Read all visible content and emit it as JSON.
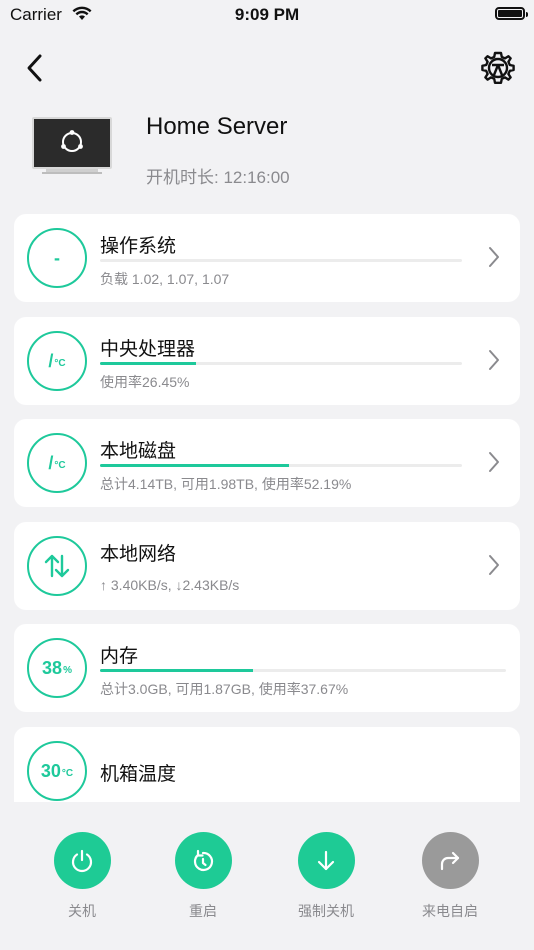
{
  "status_bar": {
    "carrier": "Carrier",
    "time": "9:09 PM"
  },
  "server": {
    "name": "Home Server",
    "uptime": "开机时长: 12:16:00"
  },
  "cards": [
    {
      "title": "操作系统",
      "ring_text": "-",
      "ring_unit": "",
      "subtitle": "负载 1.02, 1.07, 1.07",
      "progress": 0,
      "chevron": true
    },
    {
      "title": "中央处理器",
      "ring_text": "/",
      "ring_unit": "°C",
      "subtitle": "使用率26.45%",
      "progress": 0.2645,
      "chevron": true
    },
    {
      "title": "本地磁盘",
      "ring_text": "/",
      "ring_unit": "°C",
      "subtitle": "总计4.14TB, 可用1.98TB, 使用率52.19%",
      "progress": 0.5219,
      "chevron": true
    },
    {
      "title": "本地网络",
      "ring_icon": "up-down-arrows-icon",
      "subtitle": "↑ 3.40KB/s, ↓2.43KB/s",
      "chevron": true
    },
    {
      "title": "内存",
      "ring_text": "38",
      "ring_unit": "%",
      "subtitle": "总计3.0GB, 可用1.87GB, 使用率37.67%",
      "progress": 0.3767,
      "chevron": false
    },
    {
      "title": "机箱温度",
      "ring_text": "30",
      "ring_unit": "°C",
      "chevron": false
    }
  ],
  "actions": [
    {
      "label": "关机",
      "icon": "power-icon",
      "color": "#1ecb95"
    },
    {
      "label": "重启",
      "icon": "restart-icon",
      "color": "#1ecb95"
    },
    {
      "label": "强制关机",
      "icon": "down-arrow-icon",
      "color": "#1ecb95"
    },
    {
      "label": "来电自启",
      "icon": "share-arrow-icon",
      "color": "#9a9a9a"
    }
  ],
  "colors": {
    "accent": "#1ec99b",
    "disabled": "#9a9a9a",
    "background": "#f2f2f4"
  }
}
